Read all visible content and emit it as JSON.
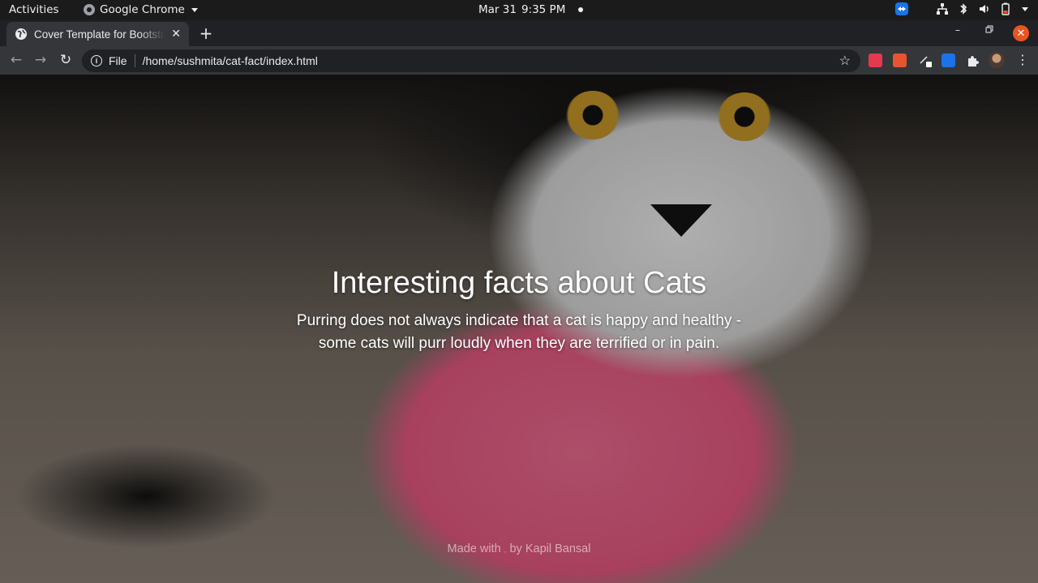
{
  "system_bar": {
    "activities": "Activities",
    "app_name": "Google Chrome",
    "date": "Mar 31",
    "time": "9:35 PM"
  },
  "tabs": [
    {
      "title": "Cover Template for Bootstrap",
      "favicon": "chrome-page-icon",
      "active": true
    }
  ],
  "toolbar": {
    "scheme_label": "File",
    "url": "/home/sushmita/cat-fact/index.html",
    "extensions": [
      "red-extension-icon",
      "orange-extension-icon",
      "white-extension-icon",
      "blue-extension-icon",
      "puzzle-icon",
      "profile-avatar"
    ]
  },
  "page": {
    "heading": "Interesting facts about Cats",
    "fact_line1": "Purring does not always indicate that a cat is happy and healthy -",
    "fact_line2": "some cats will purr loudly when they are terrified or in pain.",
    "footer_prefix": "Made with",
    "footer_suffix": "by Kapil Bansal",
    "accent_pink": "#e85a82"
  },
  "colors": {
    "window_close": "#e95420",
    "toolbar_bg": "#35363a",
    "tabstrip_bg": "#202124"
  }
}
